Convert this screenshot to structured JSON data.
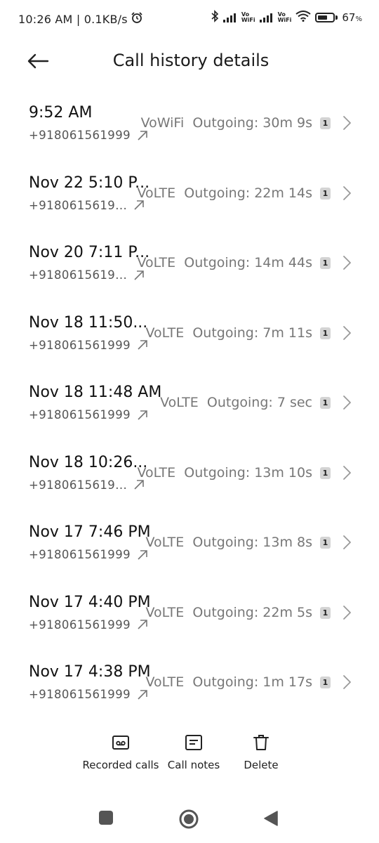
{
  "status_bar": {
    "time_speed": "10:26 AM | 0.1KB/s",
    "alarm_icon": "alarm-clock-icon",
    "bluetooth_icon": "bluetooth-icon",
    "vo_wifi_top": "Vo",
    "vo_wifi_bottom": "WiFi",
    "wifi_icon": "wifi-icon",
    "battery_percent": "67",
    "battery_unit": "%",
    "battery_level": 0.67
  },
  "header": {
    "title": "Call history details",
    "back_icon": "back-arrow-icon"
  },
  "calls": [
    {
      "time": "9:52 AM",
      "number": "+918061561999",
      "status": "VoWiFi  Outgoing: 30m 9s",
      "sim": "1"
    },
    {
      "time": "Nov 22 5:10 P...",
      "number": "+9180615619...",
      "status": "VoLTE  Outgoing: 22m 14s",
      "sim": "1"
    },
    {
      "time": "Nov 20 7:11 P...",
      "number": "+9180615619...",
      "status": "VoLTE  Outgoing: 14m 44s",
      "sim": "1"
    },
    {
      "time": "Nov 18 11:50...",
      "number": "+918061561999",
      "status": "VoLTE  Outgoing: 7m 11s",
      "sim": "1"
    },
    {
      "time": "Nov 18 11:48 AM",
      "number": "+918061561999",
      "status": "VoLTE  Outgoing: 7 sec",
      "sim": "1"
    },
    {
      "time": "Nov 18 10:26...",
      "number": "+9180615619...",
      "status": "VoLTE  Outgoing: 13m 10s",
      "sim": "1"
    },
    {
      "time": "Nov 17 7:46 PM",
      "number": "+918061561999",
      "status": "VoLTE  Outgoing: 13m 8s",
      "sim": "1"
    },
    {
      "time": "Nov 17 4:40 PM",
      "number": "+918061561999",
      "status": "VoLTE  Outgoing: 22m 5s",
      "sim": "1"
    },
    {
      "time": "Nov 17 4:38 PM",
      "number": "+918061561999",
      "status": "VoLTE  Outgoing: 1m 17s",
      "sim": "1"
    }
  ],
  "actions": {
    "recorded_calls": "Recorded calls",
    "call_notes": "Call notes",
    "delete": "Delete"
  },
  "colors": {
    "text_primary": "#111111",
    "text_secondary": "#777777",
    "sim_badge_bg": "#d4d4d4"
  }
}
